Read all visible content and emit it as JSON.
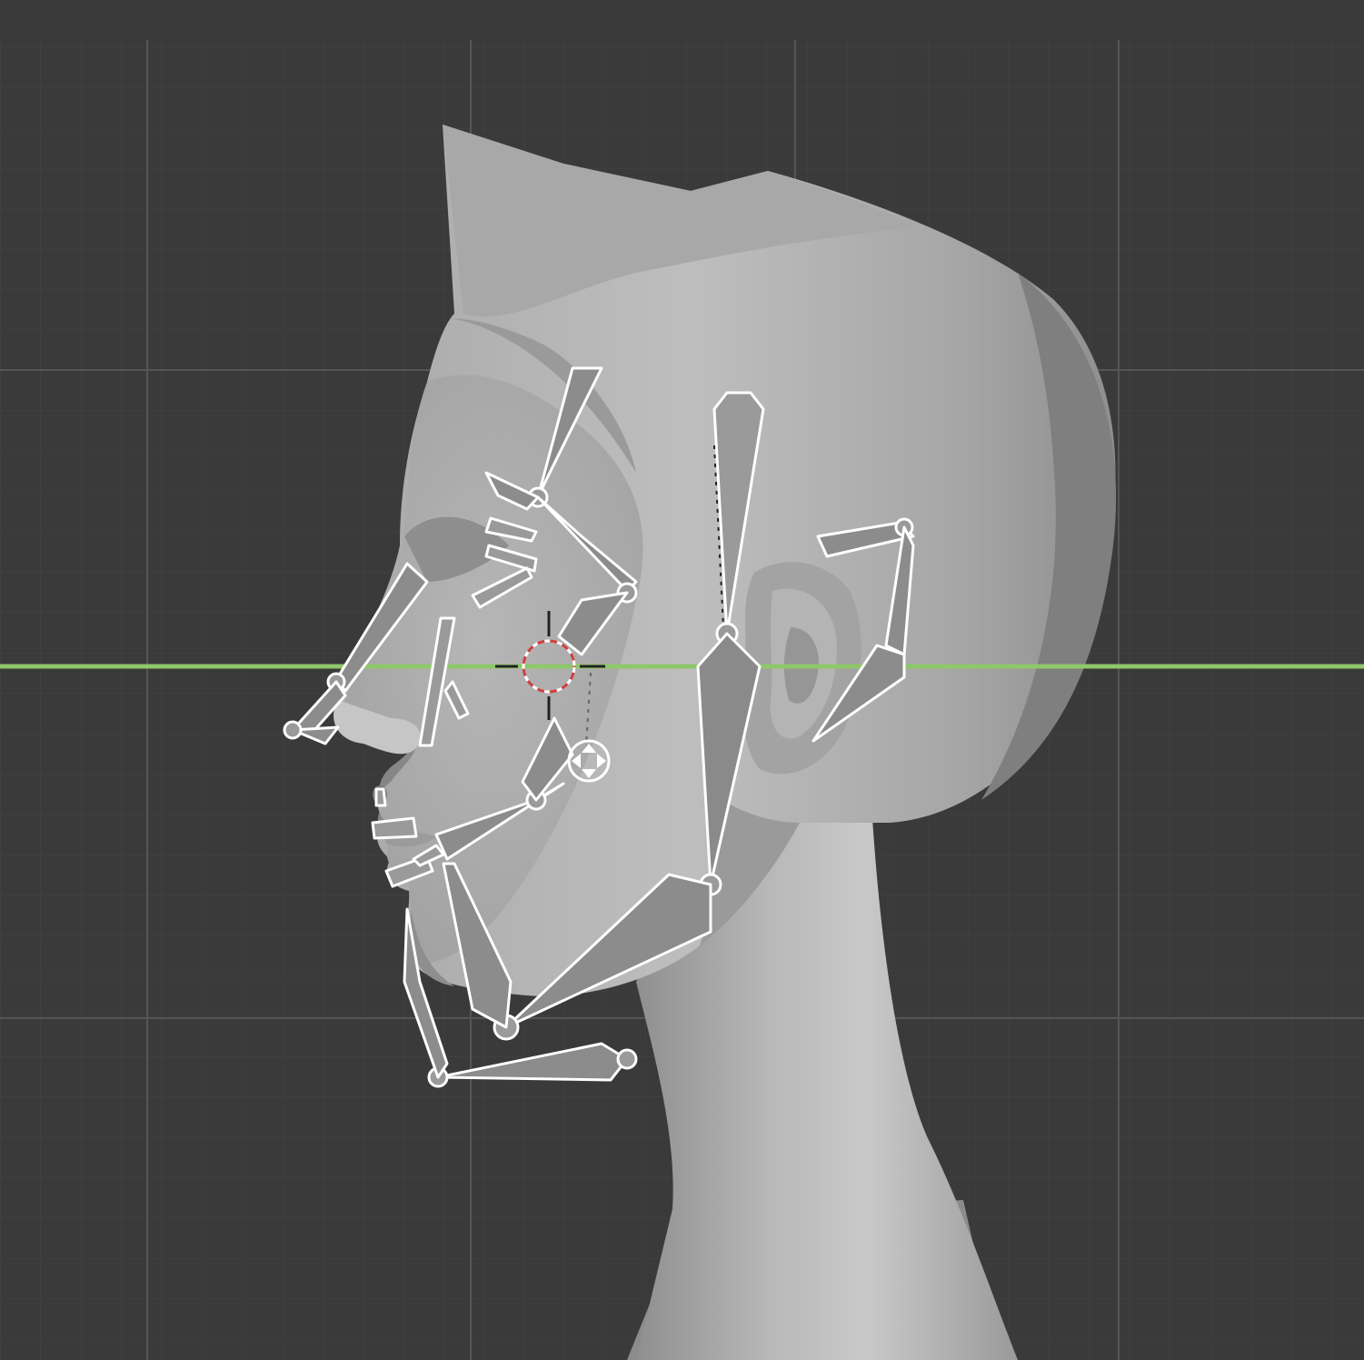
{
  "app": {
    "name": "",
    "view_label": ""
  },
  "viewport": {
    "background_color": "#3a3a3a",
    "grid_minor_color": "#444444",
    "grid_major_color": "#525252",
    "horizon_color": "#8fc76a",
    "mesh_color": "#b9b9b9",
    "armature_outline_color": "#ffffff",
    "armature_fill_color": "#8a8a8a"
  },
  "scene": {
    "object": "head-mesh",
    "armature": "face-rig",
    "icons": [
      "3d-cursor-icon",
      "object-origin-icon"
    ]
  }
}
